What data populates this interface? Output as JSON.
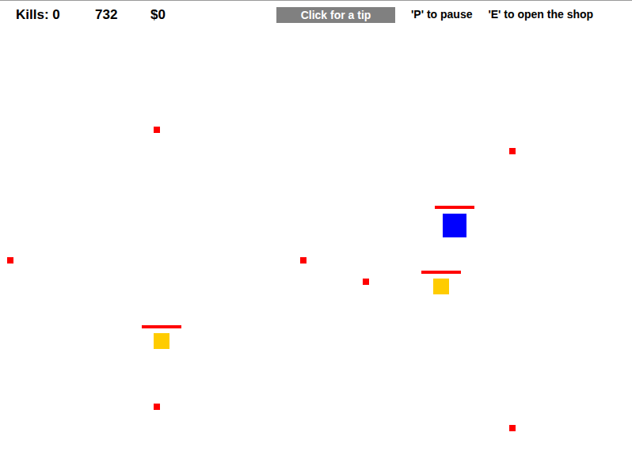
{
  "hud": {
    "kills": "Kills: 0",
    "score": "732",
    "money": "$0",
    "tip_button": "Click for a tip",
    "hints": [
      "'P' to pause",
      "'E' to open the shop"
    ]
  },
  "entities": [
    {
      "kind": "dot",
      "color": "#ff0000"
    },
    {
      "kind": "dot",
      "color": "#ff0000"
    },
    {
      "kind": "player",
      "color": "#0000ff",
      "level": 1
    },
    {
      "kind": "dot",
      "color": "#ff0000"
    },
    {
      "kind": "dot",
      "color": "#ff0000"
    },
    {
      "kind": "dot",
      "color": "#ff0000"
    },
    {
      "kind": "enemy",
      "color": "#ffcc00",
      "level": 1
    },
    {
      "kind": "enemy",
      "color": "#ffcc00",
      "level": 1
    },
    {
      "kind": "dot",
      "color": "#ff0000"
    },
    {
      "kind": "dot",
      "color": "#ff0000"
    }
  ]
}
